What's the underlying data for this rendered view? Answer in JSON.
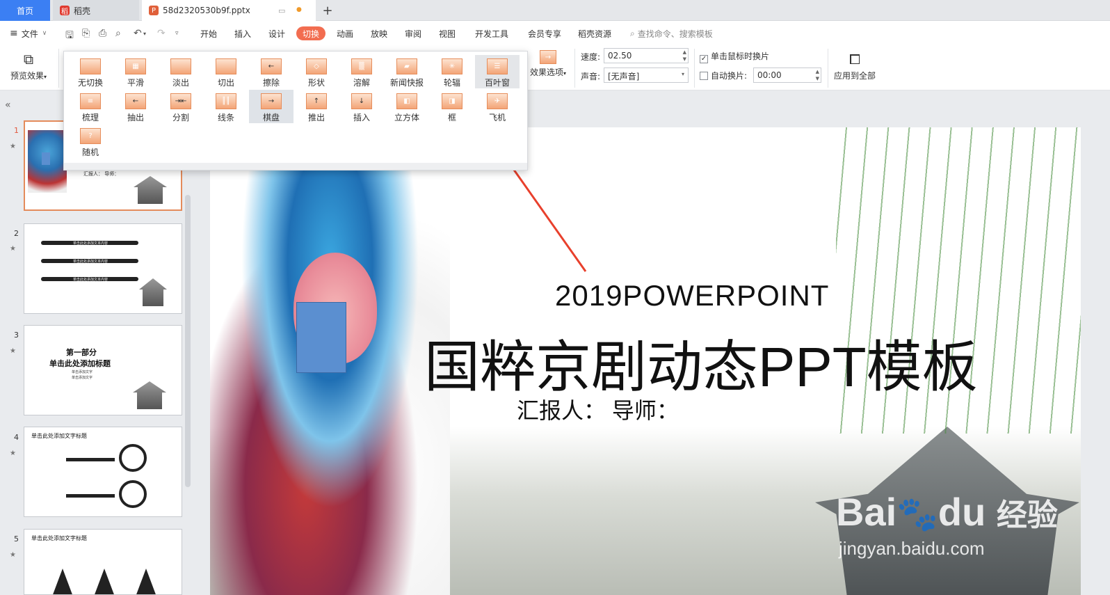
{
  "tabs": {
    "home": "首页",
    "daoke": "稻壳",
    "doc": "58d2320530b9f.pptx"
  },
  "menu": {
    "file": "文件",
    "items": [
      "开始",
      "插入",
      "设计",
      "切换",
      "动画",
      "放映",
      "审阅",
      "视图",
      "开发工具",
      "会员专享",
      "稻壳资源"
    ],
    "active_index": 3,
    "search_placeholder": "查找命令、搜索模板"
  },
  "ribbon": {
    "preview": "预览效果",
    "effect_options": "效果选项",
    "speed_label": "速度:",
    "speed_value": "02.50",
    "sound_label": "声音:",
    "sound_value": "[无声音]",
    "click_advance": "单击鼠标时换片",
    "click_advance_checked": true,
    "auto_advance": "自动换片:",
    "auto_advance_checked": false,
    "auto_time": "00:00",
    "apply_all": "应用到全部"
  },
  "transitions": {
    "items": [
      "无切换",
      "平滑",
      "淡出",
      "切出",
      "擦除",
      "形状",
      "溶解",
      "新闻快报",
      "轮辐",
      "百叶窗",
      "梳理",
      "抽出",
      "分割",
      "线条",
      "棋盘",
      "推出",
      "插入",
      "立方体",
      "框",
      "飞机",
      "随机"
    ],
    "selected": "百叶窗",
    "hovered": "棋盘"
  },
  "slides": {
    "numbers": [
      "1",
      "2",
      "3",
      "4",
      "5"
    ],
    "s2_lines": [
      "单击此处添加文本内容",
      "单击此处添加文本内容",
      "单击此处添加文本内容"
    ],
    "s3_title": "第一部分",
    "s3_sub": "单击此处添加标题",
    "s3_bullets": [
      "单击添加文字",
      "单击添加文字"
    ],
    "s4_title": "单击此处添加文字标题",
    "s5_title": "单击此处添加文字标题"
  },
  "slide": {
    "line1": "2019POWERPOINT",
    "line2": "国粹京剧动态PPT模板",
    "line3": "汇报人：  导师：",
    "thumb_reporter": "汇报人：  导师："
  },
  "watermark": {
    "brand": "Bai",
    "brand2": "du",
    "cn": "经验",
    "url": "jingyan.baidu.com"
  },
  "colors": {
    "accent": "#f26d50",
    "tab_home": "#3b7ff3",
    "arrow": "#e8402c",
    "placeholder_box": "#5b8fd0"
  }
}
